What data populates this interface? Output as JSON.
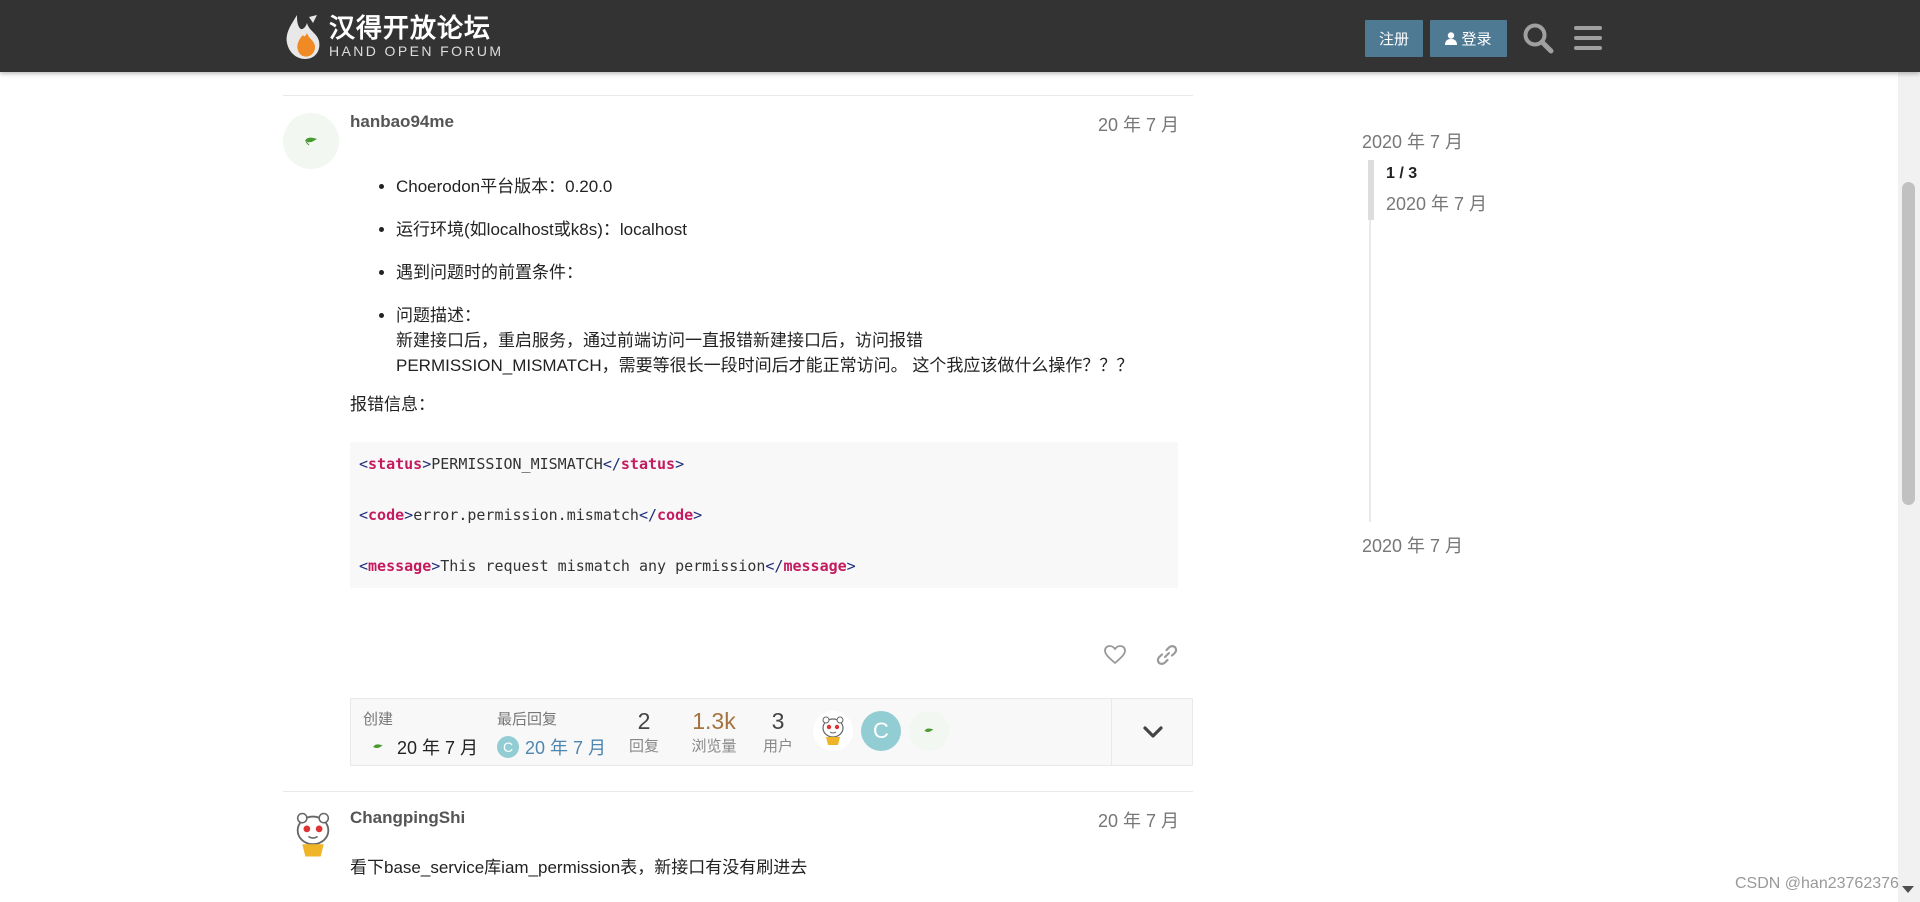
{
  "header": {
    "logo_cn": "汉得开放论坛",
    "logo_en": "HAND OPEN FORUM",
    "register_label": "注册",
    "login_label": "登录",
    "icons": [
      "search-icon",
      "hamburger-menu-icon",
      "user-icon"
    ]
  },
  "post1": {
    "username": "hanbao94me",
    "date": "20 年 7 月",
    "bullets": [
      "Choerodon平台版本：0.20.0",
      "运行环境(如localhost或k8s)：localhost",
      "遇到问题时的前置条件："
    ],
    "issue_title": "问题描述：",
    "issue_line1": "新建接口后，重启服务，通过前端访问一直报错新建接口后，访问报错",
    "issue_line2": "PERMISSION_MISMATCH，需要等很长一段时间后才能正常访问。 这个我应该做什么操作？？？",
    "error_label": "报错信息：",
    "code": [
      {
        "tag": "status",
        "text": "PERMISSION_MISMATCH"
      },
      {
        "tag": "code",
        "text": "error.permission.mismatch"
      },
      {
        "tag": "message",
        "text": "This request mismatch any permission"
      }
    ]
  },
  "topic_map": {
    "created_label": "创建",
    "created_date": "20 年 7 月",
    "last_reply_label": "最后回复",
    "last_reply_date": "20 年 7 月",
    "last_reply_avatar_letter": "C",
    "replies": "2",
    "replies_label": "回复",
    "views": "1.3k",
    "views_label": "浏览量",
    "users": "3",
    "users_label": "用户",
    "participant_letter": "C"
  },
  "post2": {
    "username": "ChangpingShi",
    "date": "20 年 7 月",
    "text": "看下base_service库iam_permission表，新接口有没有刷进去"
  },
  "timeline": {
    "start_date": "2020 年 7 月",
    "position": "1 / 3",
    "position_date": "2020 年 7 月",
    "end_date": "2020 年 7 月"
  },
  "watermark": "CSDN @han23762376",
  "colors": {
    "header_bg": "#333333",
    "button_bg": "#4f7a94",
    "views_hot": "#a37440",
    "link": "#4e86b0"
  }
}
